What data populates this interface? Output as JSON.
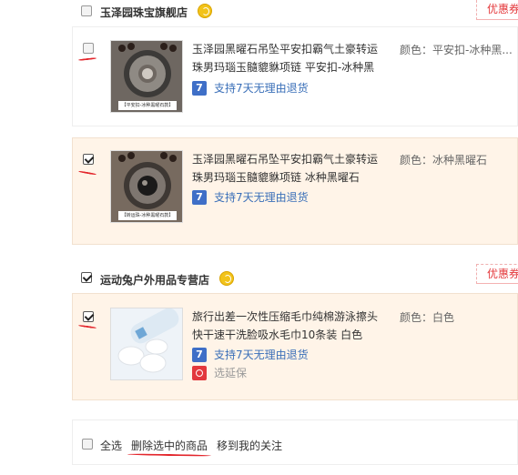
{
  "shops": [
    {
      "name": "玉泽园珠宝旗舰店",
      "coupon": "优惠券"
    },
    {
      "name": "运动兔户外用品专营店",
      "coupon": "优惠券"
    }
  ],
  "items": [
    {
      "title": "玉泽园黑曜石吊坠平安扣霸气土豪转运珠男玛瑙玉髓貔貅项链 平安扣-冰种黑",
      "prop": "颜色：平安扣-冰种黑...",
      "service": "支持7天无理由退货",
      "checked": false,
      "thumb_caption": "【平安扣-冰种黑曜石款】"
    },
    {
      "title": "玉泽园黑曜石吊坠平安扣霸气土豪转运珠男玛瑙玉髓貔貅项链 冰种黑曜石",
      "prop": "颜色：冰种黑曜石",
      "service": "支持7天无理由退货",
      "checked": true,
      "thumb_caption": "【转运珠-冰种黑曜石款】"
    },
    {
      "title": "旅行出差一次性压缩毛巾纯棉游泳擦头快干速干洗脸吸水毛巾10条装 白色",
      "prop": "颜色：白色",
      "service": "支持7天无理由退货",
      "extended": "选延保",
      "checked": true
    }
  ],
  "service_icon": "7",
  "footer": {
    "select_all": "全选",
    "delete_selected": "删除选中的商品",
    "move_to_follow": "移到我的关注"
  },
  "colors": {
    "accent_red": "#e4393c",
    "link_blue": "#3a6fb8",
    "selected_bg": "#fff4e8",
    "annotation_red": "#e3262c"
  }
}
